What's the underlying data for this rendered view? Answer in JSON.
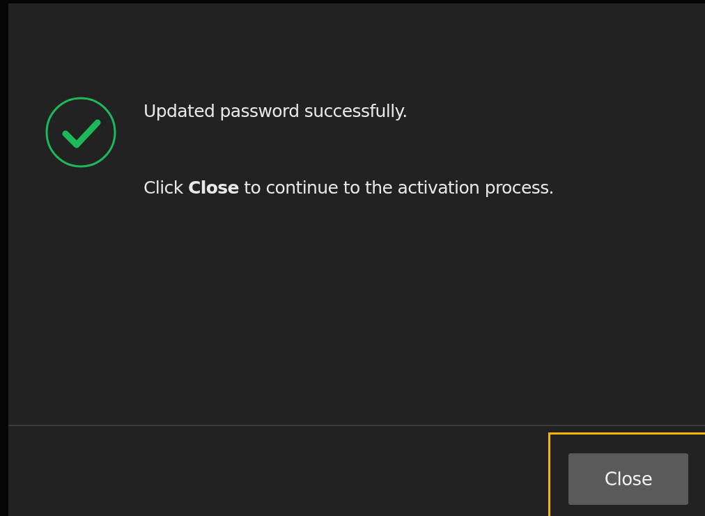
{
  "dialog": {
    "success": true,
    "message": "Updated password successfully.",
    "instruction": "Click **Close** to continue to the activation process."
  },
  "buttons": [
    {
      "label": "Close",
      "highlighted": true
    }
  ]
}
